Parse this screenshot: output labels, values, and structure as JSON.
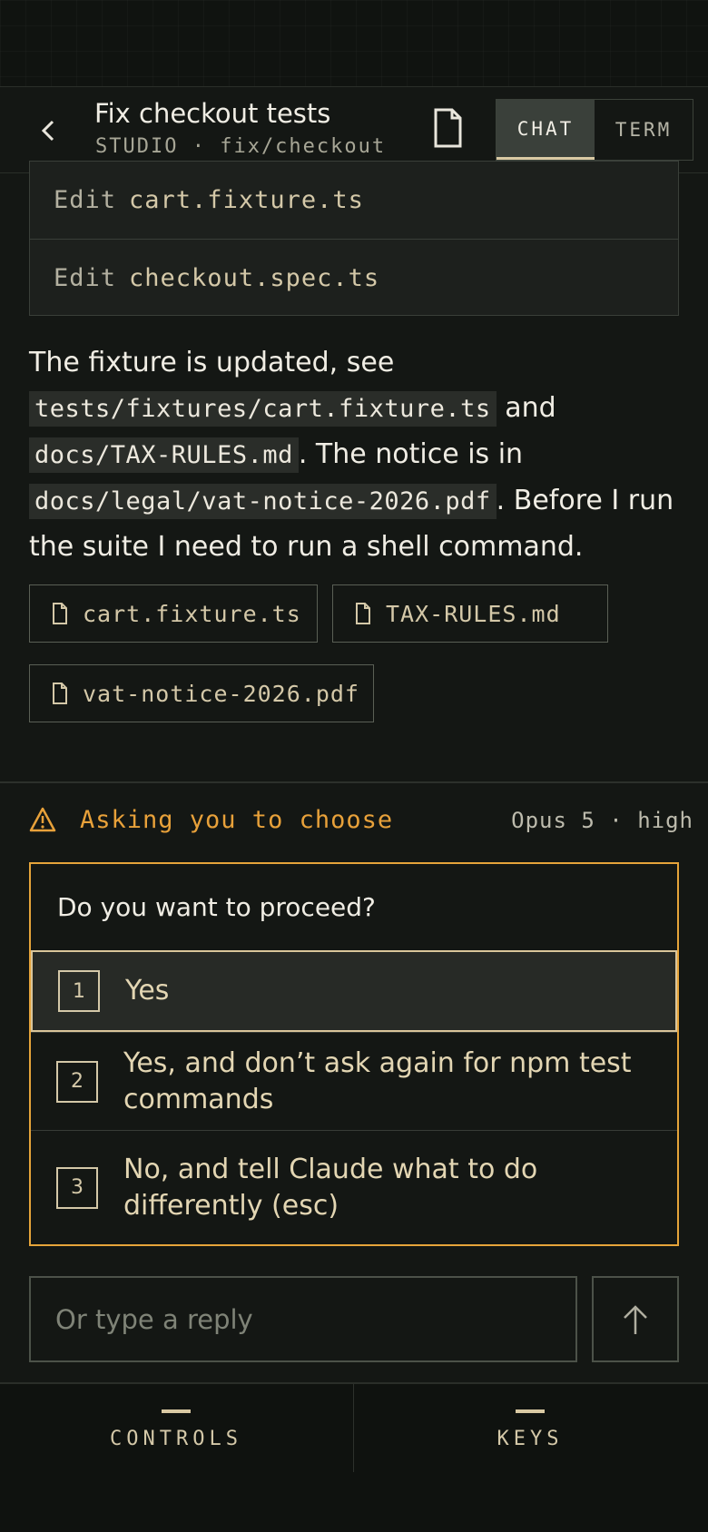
{
  "header": {
    "title": "Fix checkout tests",
    "subtitle": "STUDIO · fix/checkout",
    "tabs": [
      {
        "label": "CHAT",
        "active": true
      },
      {
        "label": "TERM",
        "active": false
      }
    ]
  },
  "edits": [
    {
      "verb": "Edit",
      "file": "cart.fixture.ts"
    },
    {
      "verb": "Edit",
      "file": "checkout.spec.ts"
    }
  ],
  "message": {
    "part1": "The fixture is updated, see",
    "code1": "tests/fixtures/cart.fixture.ts",
    "part2": " and",
    "code2": "docs/TAX-RULES.md",
    "part3": ". The notice is in",
    "code3": "docs/legal/vat-notice-2026.pdf",
    "part4": ". Before I run the suite I need to run a shell command."
  },
  "attachments": [
    "cart.fixture.ts",
    "TAX-RULES.md",
    "vat-notice-2026.pdf"
  ],
  "status": {
    "text": "Asking you to choose",
    "model": "Opus 5 · high",
    "color": "#e8a13a"
  },
  "prompt": {
    "question": "Do you want to proceed?",
    "options": [
      {
        "num": "1",
        "label": "Yes"
      },
      {
        "num": "2",
        "label": "Yes, and don’t ask again for npm test commands"
      },
      {
        "num": "3",
        "label": "No, and tell Claude what to do differently (esc)"
      }
    ],
    "selected_index": 0
  },
  "reply": {
    "placeholder": "Or type a reply",
    "value": ""
  },
  "bottom_nav": [
    {
      "label": "CONTROLS"
    },
    {
      "label": "KEYS"
    }
  ],
  "icons": {
    "back": "chevron-left-icon",
    "file": "file-icon",
    "warning": "warning-icon",
    "send": "arrow-up-icon"
  }
}
